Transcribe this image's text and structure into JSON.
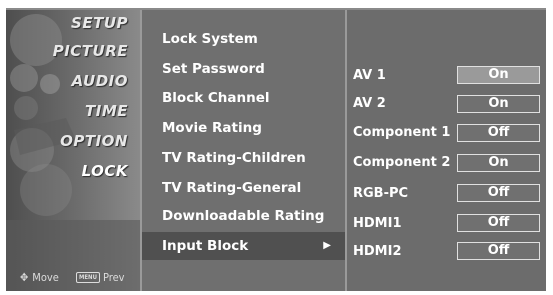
{
  "sidebar": {
    "items": [
      {
        "label": "SETUP"
      },
      {
        "label": "PICTURE"
      },
      {
        "label": "AUDIO"
      },
      {
        "label": "TIME"
      },
      {
        "label": "OPTION"
      },
      {
        "label": "LOCK"
      }
    ],
    "hint_move": "Move",
    "hint_menu_key": "MENU",
    "hint_prev": "Prev"
  },
  "menu": {
    "items": [
      {
        "label": "Lock System"
      },
      {
        "label": "Set Password"
      },
      {
        "label": "Block Channel"
      },
      {
        "label": "Movie Rating"
      },
      {
        "label": "TV Rating-Children"
      },
      {
        "label": "TV Rating-General"
      },
      {
        "label": "Downloadable Rating"
      },
      {
        "label": "Input Block"
      }
    ],
    "selected_arrow": "▶"
  },
  "input_block": {
    "rows": [
      {
        "source": "AV 1",
        "value": "On"
      },
      {
        "source": "AV 2",
        "value": "On"
      },
      {
        "source": "Component 1",
        "value": "Off"
      },
      {
        "source": "Component 2",
        "value": "On"
      },
      {
        "source": "RGB-PC",
        "value": "Off"
      },
      {
        "source": "HDMI1",
        "value": "Off"
      },
      {
        "source": "HDMI2",
        "value": "Off"
      }
    ]
  },
  "colors": {
    "panel": "#6c6c6c",
    "selected_row": "#505050",
    "text": "#ffffff"
  }
}
